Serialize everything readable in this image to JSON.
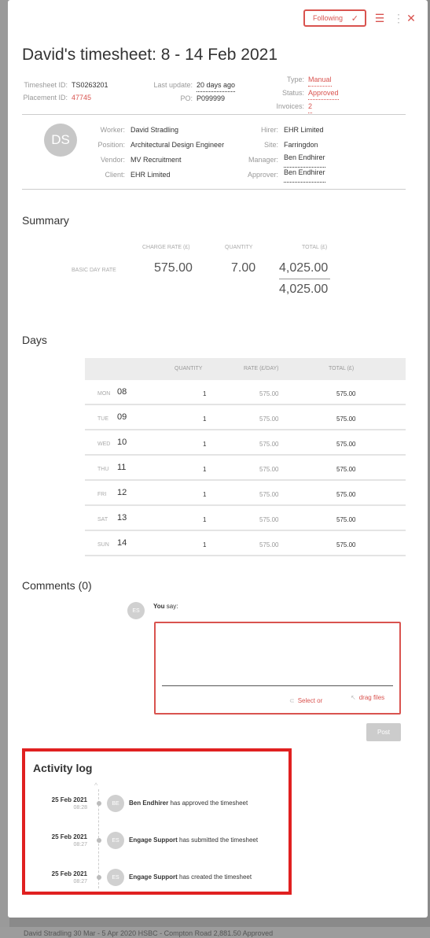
{
  "header": {
    "following_label": "Following",
    "title": "David's timesheet: 8 - 14 Feb 2021"
  },
  "meta": {
    "timesheet_id_label": "Timesheet ID:",
    "timesheet_id": "TS0263201",
    "placement_id_label": "Placement ID:",
    "placement_id": "47745",
    "last_update_label": "Last update:",
    "last_update": "20 days ago",
    "po_label": "PO:",
    "po": "P099999",
    "type_label": "Type:",
    "type": "Manual",
    "status_label": "Status:",
    "status": "Approved",
    "invoices_label": "Invoices:",
    "invoices": "2"
  },
  "people": {
    "initials": "DS",
    "worker_label": "Worker:",
    "worker": "David Stradling",
    "position_label": "Position:",
    "position": "Architectural Design Engineer",
    "vendor_label": "Vendor:",
    "vendor": "MV Recruitment",
    "client_label": "Client:",
    "client": "EHR Limited",
    "hirer_label": "Hirer:",
    "hirer": "EHR Limited",
    "site_label": "Site:",
    "site": "Farringdon",
    "manager_label": "Manager:",
    "manager": "Ben Endhirer",
    "approver_label": "Approver:",
    "approver": "Ben Endhirer"
  },
  "summary": {
    "title": "Summary",
    "charge_rate_header": "CHARGE RATE (£)",
    "quantity_header": "QUANTITY",
    "total_header": "TOTAL (£)",
    "row_label": "BASIC DAY RATE",
    "charge_rate": "575.00",
    "quantity": "7.00",
    "total": "4,025.00",
    "grand_total": "4,025.00"
  },
  "days": {
    "title": "Days",
    "quantity_header": "QUANTITY",
    "rate_header": "RATE (£/DAY)",
    "total_header": "TOTAL (£)",
    "rows": [
      {
        "day": "MON",
        "date": "08",
        "quantity": "1",
        "rate": "575.00",
        "total": "575.00"
      },
      {
        "day": "TUE",
        "date": "09",
        "quantity": "1",
        "rate": "575.00",
        "total": "575.00"
      },
      {
        "day": "WED",
        "date": "10",
        "quantity": "1",
        "rate": "575.00",
        "total": "575.00"
      },
      {
        "day": "THU",
        "date": "11",
        "quantity": "1",
        "rate": "575.00",
        "total": "575.00"
      },
      {
        "day": "FRI",
        "date": "12",
        "quantity": "1",
        "rate": "575.00",
        "total": "575.00"
      },
      {
        "day": "SAT",
        "date": "13",
        "quantity": "1",
        "rate": "575.00",
        "total": "575.00"
      },
      {
        "day": "SUN",
        "date": "14",
        "quantity": "1",
        "rate": "575.00",
        "total": "575.00"
      }
    ]
  },
  "comments": {
    "title": "Comments (0)",
    "avatar": "ES",
    "you": "You",
    "say": "say:",
    "select_label": "Select or",
    "drag_label": "drag files",
    "post_label": "Post"
  },
  "activity": {
    "title": "Activity log",
    "items": [
      {
        "date": "25 Feb 2021",
        "time": "08:28",
        "avatar": "BE",
        "actor": "Ben Endhirer",
        "action": "has approved the timesheet"
      },
      {
        "date": "25 Feb 2021",
        "time": "08:27",
        "avatar": "ES",
        "actor": "Engage Support",
        "action": "has submitted the timesheet"
      },
      {
        "date": "25 Feb 2021",
        "time": "08:27",
        "avatar": "ES",
        "actor": "Engage Support",
        "action": "has created the timesheet"
      }
    ]
  },
  "background": {
    "row_text": "David Stradling        30 Mar - 5 Apr 2020        HSBC - Compton Road        2,881.50        Approved"
  }
}
